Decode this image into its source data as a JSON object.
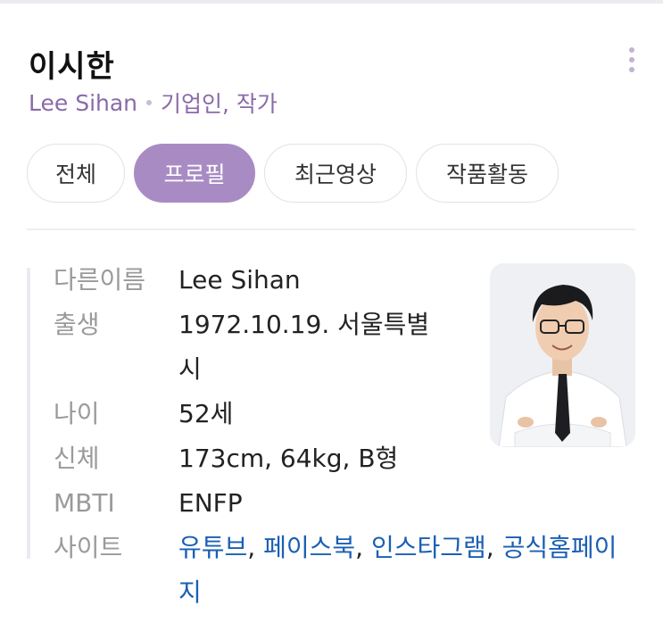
{
  "header": {
    "name": "이시한",
    "english_name": "Lee Sihan",
    "occupation": "기업인, 작가"
  },
  "tabs": [
    {
      "label": "전체",
      "active": false
    },
    {
      "label": "프로필",
      "active": true
    },
    {
      "label": "최근영상",
      "active": false
    },
    {
      "label": "작품활동",
      "active": false
    }
  ],
  "profile": {
    "other_name_label": "다른이름",
    "other_name_value": "Lee Sihan",
    "birth_label": "출생",
    "birth_value_line1": "1972.10.19. 서울특별",
    "birth_value_line2": "시",
    "age_label": "나이",
    "age_value": "52세",
    "body_label": "신체",
    "body_value": "173cm, 64kg, B형",
    "mbti_label": "MBTI",
    "mbti_value": "ENFP",
    "site_label": "사이트",
    "sites": [
      "유튜브",
      "페이스북",
      "인스타그램",
      "공식홈페이지"
    ],
    "site_sep": ","
  },
  "colors": {
    "accent": "#a98bc4",
    "subtitle": "#8a6aa8",
    "link": "#1a5fb4"
  },
  "icons": {
    "more": "more-vertical-icon"
  }
}
